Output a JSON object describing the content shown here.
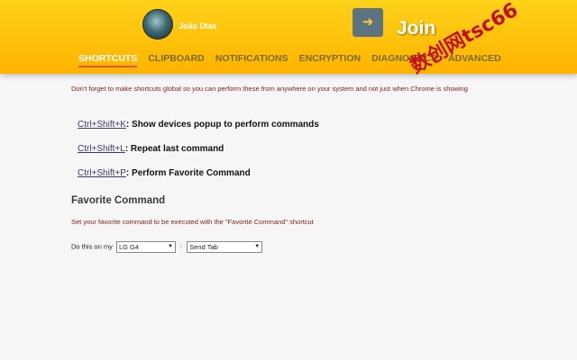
{
  "header": {
    "user_name": "João Dias",
    "app_name": "Join",
    "logo_icon": "arrow-into-device-icon"
  },
  "nav": {
    "tabs": [
      {
        "label": "SHORTCUTS",
        "active": true
      },
      {
        "label": "CLIPBOARD",
        "active": false
      },
      {
        "label": "NOTIFICATIONS",
        "active": false
      },
      {
        "label": "ENCRYPTION",
        "active": false
      },
      {
        "label": "DIAGNOSTICS",
        "active": false
      },
      {
        "label": "ADVANCED",
        "active": false
      }
    ]
  },
  "watermark": "数创网tsc66",
  "shortcuts": {
    "notice": "Don't forget to make shortcuts global so you can perform these from anywhere on your system and not just when Chrome is showing",
    "items": [
      {
        "keys": "Ctrl+Shift+K",
        "description": ": Show devices popup to perform commands"
      },
      {
        "keys": "Ctrl+Shift+L",
        "description": ": Repeat last command"
      },
      {
        "keys": "Ctrl+Shift+P",
        "description": ": Perform Favorite Command"
      }
    ]
  },
  "favorite": {
    "title": "Favorite Command",
    "description": "Set your favorite command to be executed with the \"Favorite Command\" shortcut",
    "prefix": "Do this on my",
    "device_value": "LG G4",
    "separator": ":",
    "command_value": "Send Tab"
  },
  "colors": {
    "header_top": "#ffd21a",
    "header_bottom": "#ffb300",
    "active_underline": "#e5553a",
    "notice_text": "#8c1a1a",
    "watermark": "#c0101b"
  }
}
